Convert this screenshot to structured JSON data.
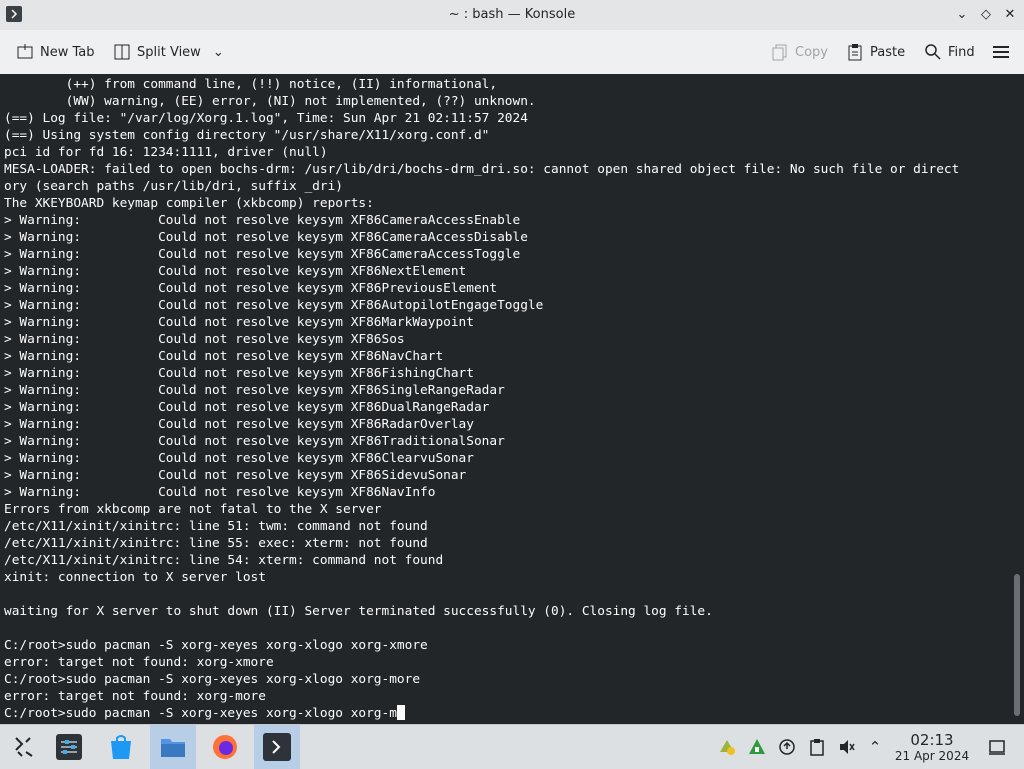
{
  "window": {
    "title": "~ : bash — Konsole",
    "controls": [
      "chevron-down-icon",
      "diamond-icon",
      "close-icon"
    ]
  },
  "toolbar": {
    "new_tab": "New Tab",
    "split_view": "Split View",
    "copy": "Copy",
    "paste": "Paste",
    "find": "Find"
  },
  "terminal": {
    "background": "#232629",
    "foreground": "#fcfcfc",
    "lines": [
      "        (++) from command line, (!!) notice, (II) informational,",
      "        (WW) warning, (EE) error, (NI) not implemented, (??) unknown.",
      "(==) Log file: \"/var/log/Xorg.1.log\", Time: Sun Apr 21 02:11:57 2024",
      "(==) Using system config directory \"/usr/share/X11/xorg.conf.d\"",
      "pci id for fd 16: 1234:1111, driver (null)",
      "MESA-LOADER: failed to open bochs-drm: /usr/lib/dri/bochs-drm_dri.so: cannot open shared object file: No such file or direct",
      "ory (search paths /usr/lib/dri, suffix _dri)",
      "The XKEYBOARD keymap compiler (xkbcomp) reports:",
      "> Warning:          Could not resolve keysym XF86CameraAccessEnable",
      "> Warning:          Could not resolve keysym XF86CameraAccessDisable",
      "> Warning:          Could not resolve keysym XF86CameraAccessToggle",
      "> Warning:          Could not resolve keysym XF86NextElement",
      "> Warning:          Could not resolve keysym XF86PreviousElement",
      "> Warning:          Could not resolve keysym XF86AutopilotEngageToggle",
      "> Warning:          Could not resolve keysym XF86MarkWaypoint",
      "> Warning:          Could not resolve keysym XF86Sos",
      "> Warning:          Could not resolve keysym XF86NavChart",
      "> Warning:          Could not resolve keysym XF86FishingChart",
      "> Warning:          Could not resolve keysym XF86SingleRangeRadar",
      "> Warning:          Could not resolve keysym XF86DualRangeRadar",
      "> Warning:          Could not resolve keysym XF86RadarOverlay",
      "> Warning:          Could not resolve keysym XF86TraditionalSonar",
      "> Warning:          Could not resolve keysym XF86ClearvuSonar",
      "> Warning:          Could not resolve keysym XF86SidevuSonar",
      "> Warning:          Could not resolve keysym XF86NavInfo",
      "Errors from xkbcomp are not fatal to the X server",
      "/etc/X11/xinit/xinitrc: line 51: twm: command not found",
      "/etc/X11/xinit/xinitrc: line 55: exec: xterm: not found",
      "/etc/X11/xinit/xinitrc: line 54: xterm: command not found",
      "xinit: connection to X server lost",
      "",
      "waiting for X server to shut down (II) Server terminated successfully (0). Closing log file.",
      "",
      "C:/root>sudo pacman -S xorg-xeyes xorg-xlogo xorg-xmore",
      "error: target not found: xorg-xmore",
      "C:/root>sudo pacman -S xorg-xeyes xorg-xlogo xorg-more",
      "error: target not found: xorg-more"
    ],
    "prompt_line": "C:/root>sudo pacman -S xorg-xeyes xorg-xlogo xorg-m"
  },
  "taskbar": {
    "apps": [
      "application-launcher-icon",
      "system-settings-icon",
      "discover-icon",
      "dolphin-icon",
      "firefox-icon",
      "konsole-icon"
    ],
    "tray": [
      "updates-icon",
      "gaming-icon",
      "network-icon",
      "clipboard-icon",
      "volume-muted-icon",
      "tray-expand-icon"
    ],
    "clock_time": "02:13",
    "clock_date": "21 Apr 2024",
    "show_desktop": "show-desktop-icon"
  }
}
